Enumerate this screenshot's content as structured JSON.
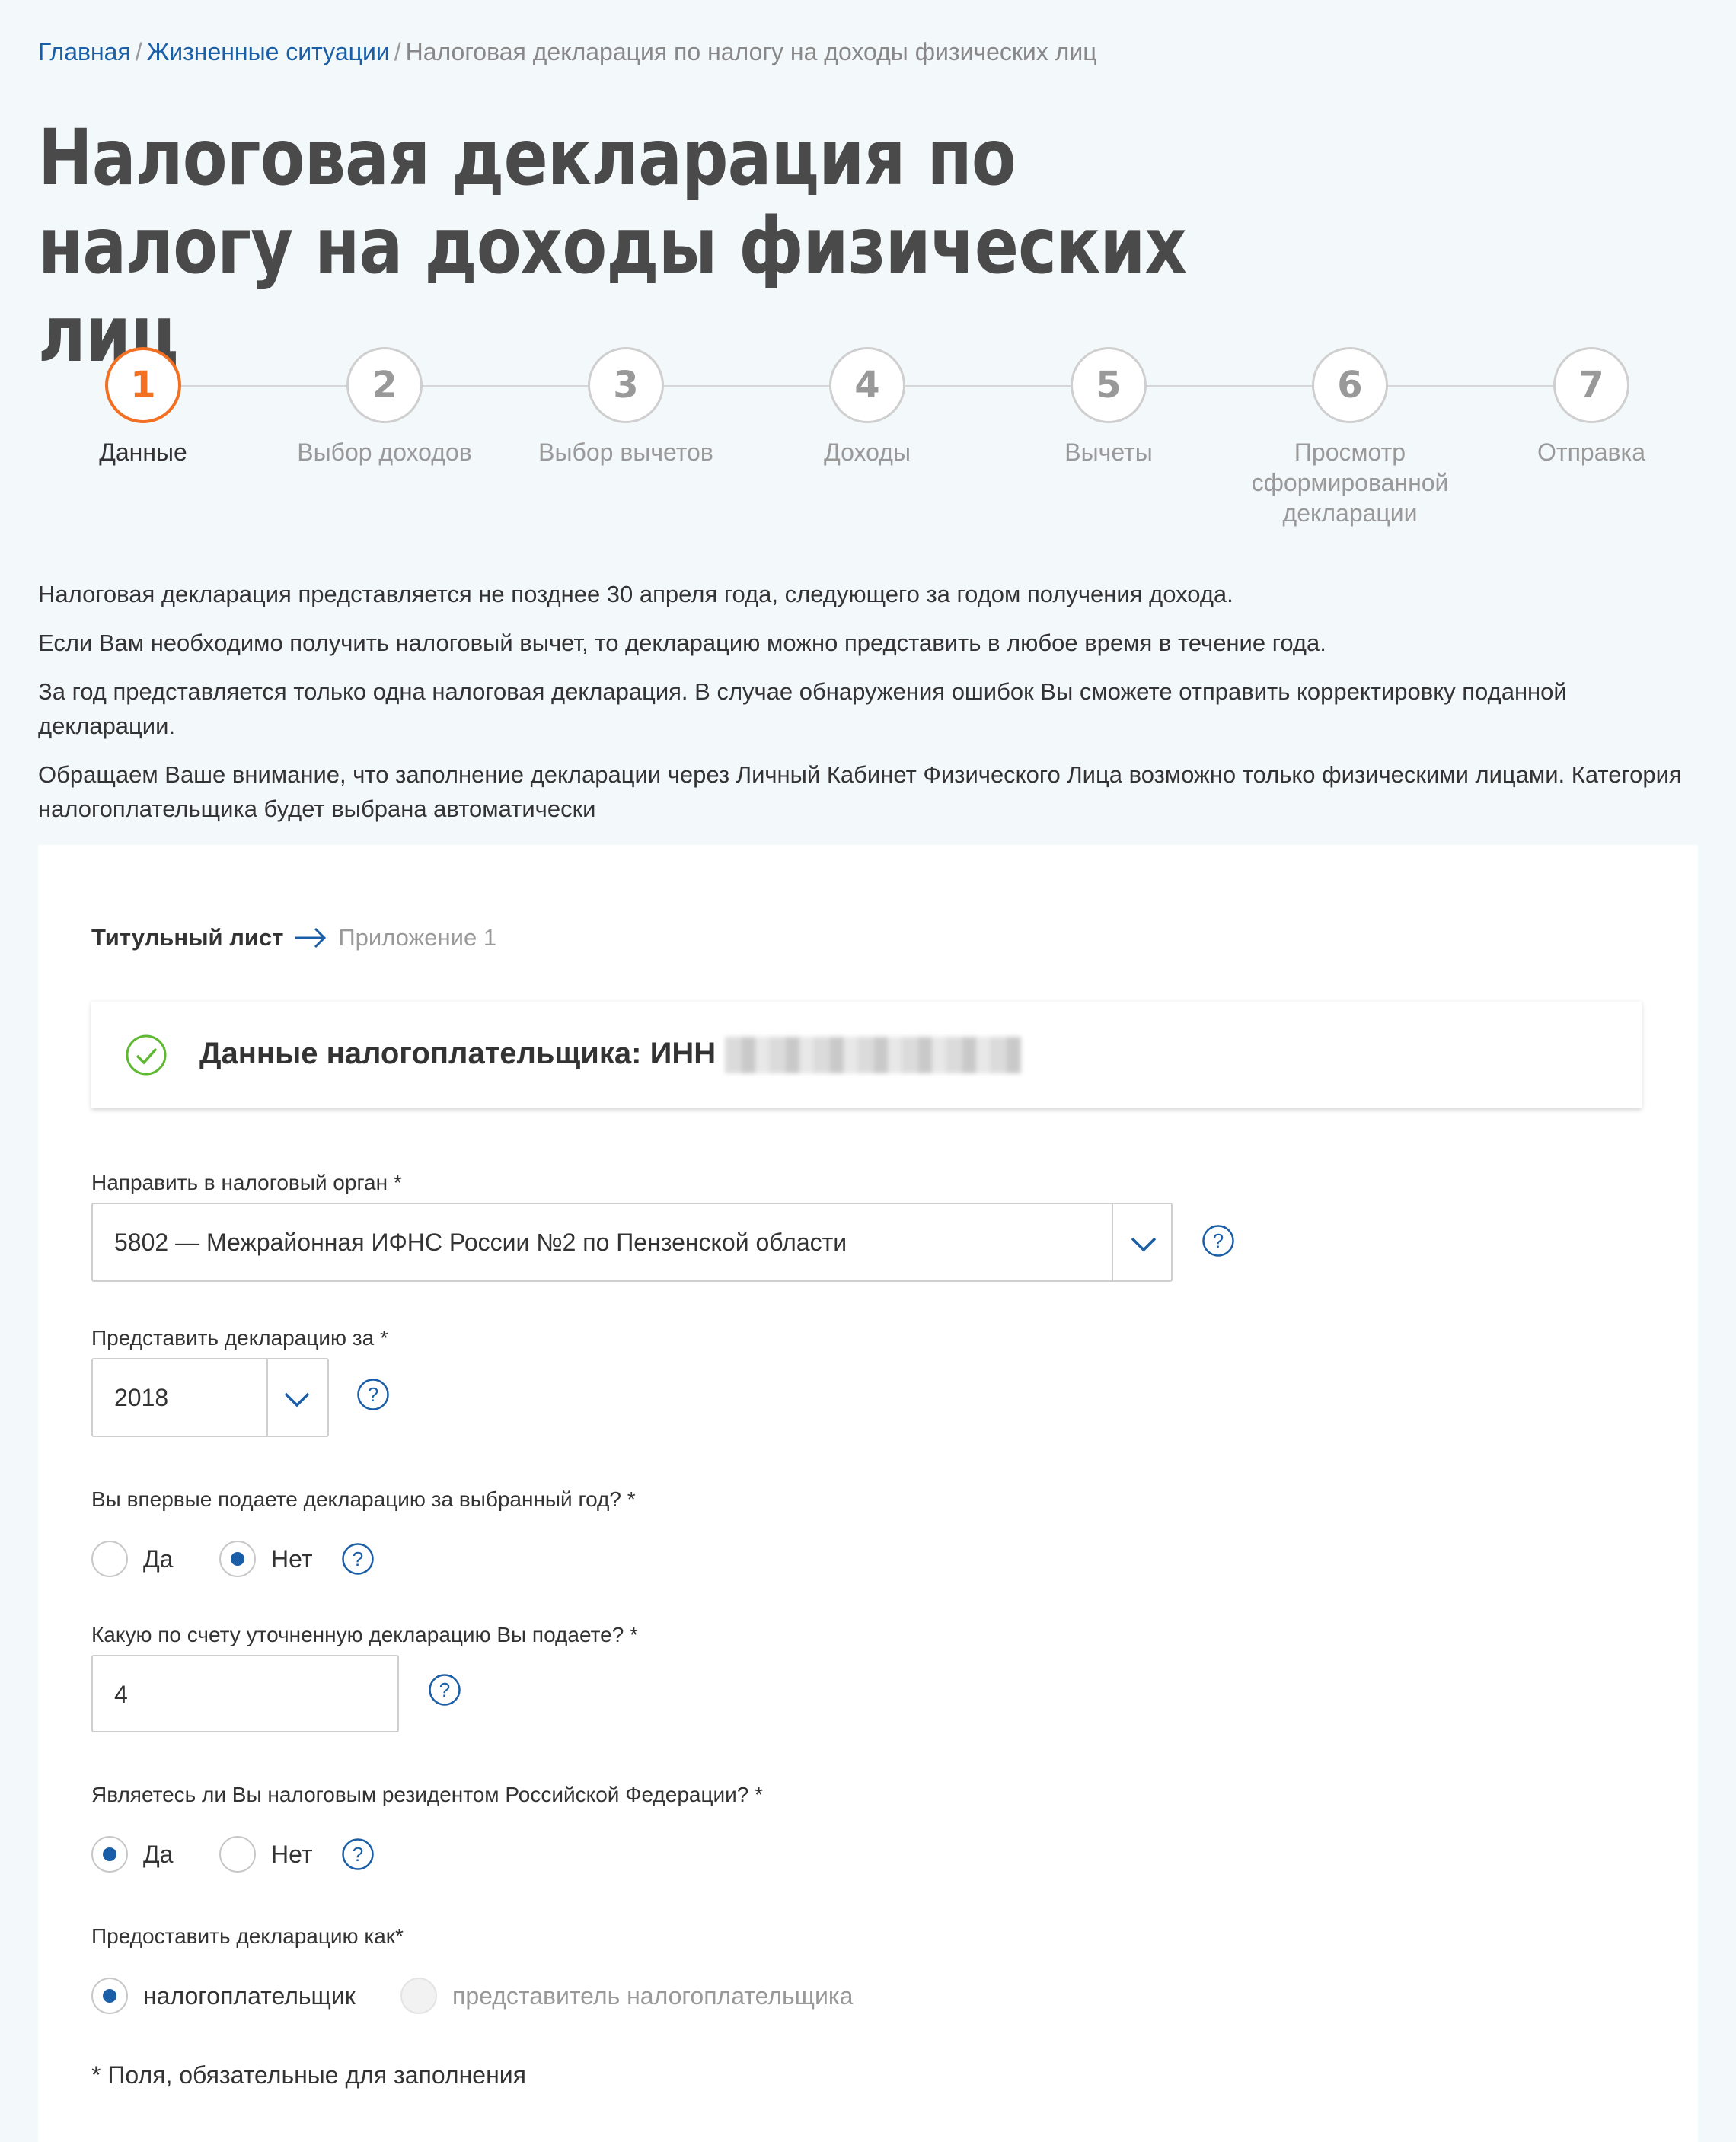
{
  "breadcrumb": {
    "home": "Главная",
    "sep1": "/",
    "section": "Жизненные ситуации",
    "sep2": "/",
    "current": "Налоговая декларация по налогу на доходы физических лиц"
  },
  "page_title": "Налоговая декларация по налогу на доходы физических лиц",
  "stepper": {
    "active_step": 1,
    "steps": [
      {
        "number": "1",
        "label": "Данные"
      },
      {
        "number": "2",
        "label": "Выбор доходов"
      },
      {
        "number": "3",
        "label": "Выбор вычетов"
      },
      {
        "number": "4",
        "label": "Доходы"
      },
      {
        "number": "5",
        "label": "Вычеты"
      },
      {
        "number": "6",
        "label": "Просмотр сформированной декларации"
      },
      {
        "number": "7",
        "label": "Отправка"
      }
    ]
  },
  "info": {
    "p1": "Налоговая декларация представляется не позднее 30 апреля года, следующего за годом получения дохода.",
    "p2": "Если Вам необходимо получить налоговый вычет, то декларацию можно представить в любое время в течение года.",
    "p3": "За год представляется только одна налоговая декларация. В случае обнаружения ошибок Вы сможете отправить корректировку поданной декларации.",
    "p4": "Обращаем Ваше внимание, что заполнение декларации через Личный Кабинет Физического Лица возможно только физическими лицами. Категория налогоплательщика будет выбрана автоматически"
  },
  "subnav": {
    "current": "Титульный лист",
    "next": "Приложение 1"
  },
  "taxpayer": {
    "title": "Данные налогоплательщика: ИНН"
  },
  "form": {
    "tax_authority": {
      "label": "Направить в налоговый орган *",
      "value": "5802 — Межрайонная ИФНС России №2 по Пензенской области"
    },
    "year": {
      "label": "Представить декларацию за *",
      "value": "2018"
    },
    "first_time": {
      "label": "Вы впервые подаете декларацию за выбранный год? *",
      "options": [
        "Да",
        "Нет"
      ],
      "selected": "Нет"
    },
    "correction_number": {
      "label": "Какую по счету уточненную декларацию Вы подаете? *",
      "value": "4"
    },
    "resident": {
      "label": "Являетесь ли Вы налоговым резидентом Российской Федерации? *",
      "options": [
        "Да",
        "Нет"
      ],
      "selected": "Да"
    },
    "submit_as": {
      "label": "Предоставить декларацию как*",
      "options": [
        "налогоплательщик",
        "представитель налогоплательщика"
      ],
      "selected": "налогоплательщик",
      "disabled": [
        "представитель налогоплательщика"
      ]
    }
  },
  "required_note": "* Поля, обязательные для заполнения",
  "colors": {
    "accent": "#f36f21",
    "link": "#1a5ea7",
    "success": "#5fb832",
    "background": "#f3f8fa"
  }
}
